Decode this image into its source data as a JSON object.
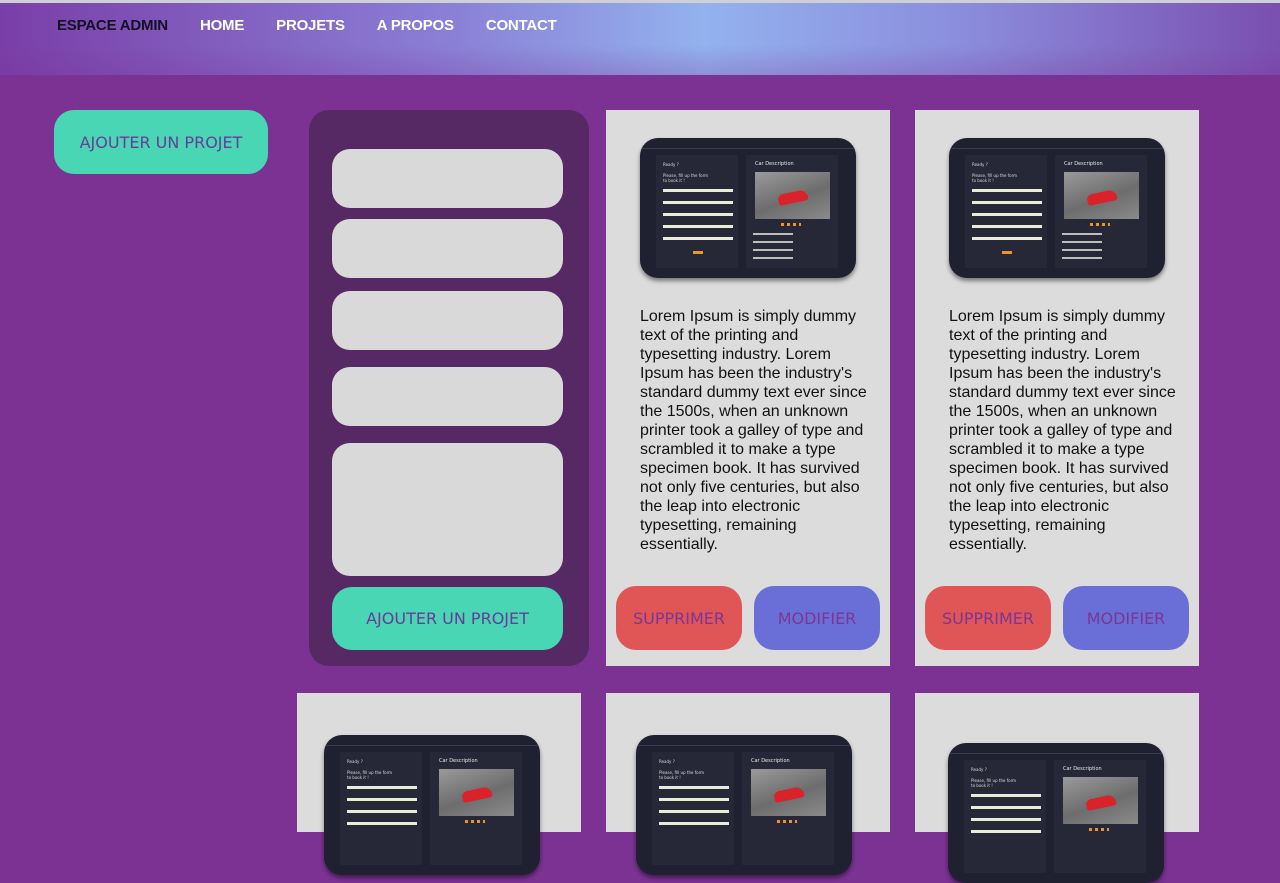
{
  "nav": {
    "brand": "ESPACE ADMIN",
    "items": [
      "HOME",
      "PROJETS",
      "A PROPOS",
      "CONTACT"
    ]
  },
  "sidebar": {
    "add_label": "AJOUTER UN PROJET"
  },
  "form": {
    "submit_label": "AJOUTER UN PROJET"
  },
  "thumbnail": {
    "left_title": "Ready ?",
    "left_subtitle": "Please, fill up the form to book it !",
    "right_title": "Car Description"
  },
  "card": {
    "description": "Lorem Ipsum is simply dummy text of the printing and typesetting industry. Lorem Ipsum has been the industry's standard dummy text ever since the 1500s, when an unknown printer took a galley of type and scrambled it to make a type specimen book. It has survived not only five centuries, but also the leap into electronic typesetting, remaining essentially.",
    "delete_label": "SUPPRIMER",
    "modify_label": "MODIFIER"
  },
  "colors": {
    "background": "#7b3293",
    "form_panel": "#562864",
    "add_button": "#48d6b5",
    "delete_button": "#e05555",
    "modify_button": "#6a6fd8",
    "card": "#dcdcdc"
  }
}
